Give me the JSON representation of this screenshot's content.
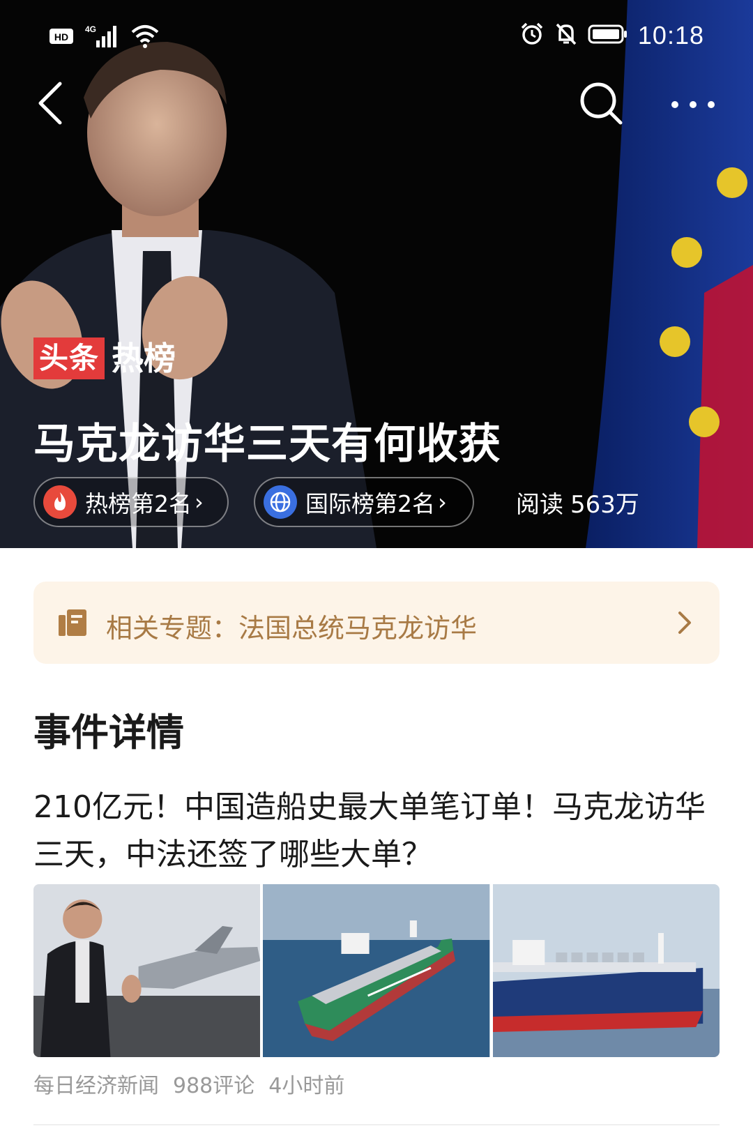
{
  "status_bar": {
    "left_icons": [
      "hd-icon",
      "signal-4g-icon",
      "wifi-icon"
    ],
    "hd_label": "HD",
    "network_label": "4G",
    "right_icons": [
      "alarm-icon",
      "mute-icon",
      "battery-icon"
    ],
    "time": "10:18"
  },
  "nav": {
    "back_icon": "chevron-left-icon",
    "search_icon": "search-icon",
    "more_icon": "more-dots-icon"
  },
  "hero": {
    "brand_red": "头条",
    "brand_white": "热榜",
    "title": "马克龙访华三天有何收获",
    "hot_rank": {
      "label": "热榜第2名",
      "icon": "flame-icon",
      "arrow": "›"
    },
    "intl_rank": {
      "label": "国际榜第2名",
      "icon": "globe-icon",
      "arrow": "›"
    },
    "reads_label": "阅读",
    "reads_value": "563万"
  },
  "topic": {
    "icon": "document-icon",
    "label": "相关专题：法国总统马克龙访华",
    "arrow_icon": "chevron-right-icon"
  },
  "section": {
    "title": "事件详情"
  },
  "article": {
    "title": "210亿元！中国造船史最大单笔订单！马克龙访华三天，中法还签了哪些大单？",
    "thumbnails": [
      "thumbnail-speaker-jet",
      "thumbnail-ship-green",
      "thumbnail-ship-blue"
    ],
    "source": "每日经济新闻",
    "comments": "988评论",
    "time": "4小时前"
  },
  "colors": {
    "brand_red": "#e33b3b",
    "topic_bg": "#fdf4e8",
    "topic_text": "#a87a45",
    "meta_text": "#999999",
    "flame": "#e84a3c",
    "globe": "#3a6fe0"
  }
}
